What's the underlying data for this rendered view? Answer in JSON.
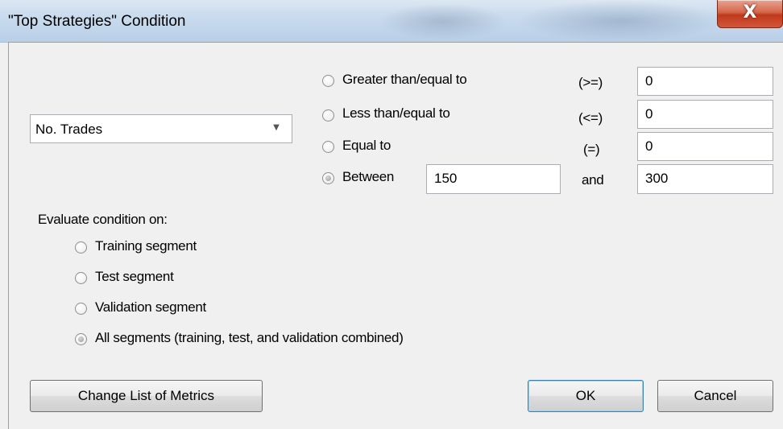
{
  "window": {
    "title": "\"Top Strategies\" Condition",
    "close_glyph": "X"
  },
  "metric_select": {
    "selected": "No. Trades"
  },
  "comparisons": [
    {
      "label": "Greater than/equal to",
      "symbol": "(>=)",
      "value": "0",
      "selected": false
    },
    {
      "label": "Less than/equal to",
      "symbol": "(<=)",
      "value": "0",
      "selected": false
    },
    {
      "label": "Equal to",
      "symbol": "(=)",
      "value": "0",
      "selected": false
    }
  ],
  "between": {
    "label": "Between",
    "low": "150",
    "joiner": "and",
    "high": "300",
    "selected": true
  },
  "evaluate": {
    "heading": "Evaluate condition on:",
    "options": [
      {
        "label": "Training segment",
        "selected": false
      },
      {
        "label": "Test segment",
        "selected": false
      },
      {
        "label": "Validation segment",
        "selected": false
      },
      {
        "label": "All segments (training, test, and validation combined)",
        "selected": true
      }
    ]
  },
  "buttons": {
    "change_metrics": "Change List of Metrics",
    "ok": "OK",
    "cancel": "Cancel"
  }
}
